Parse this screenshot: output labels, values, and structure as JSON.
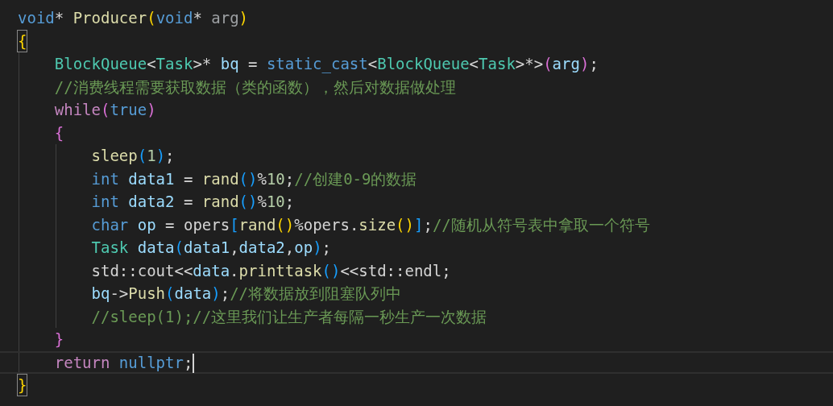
{
  "editor": {
    "lines": [
      {
        "current": false,
        "matched": false,
        "cursor": false,
        "tokens": [
          {
            "t": "void",
            "kind": "keyword"
          },
          {
            "t": "* ",
            "kind": "plain"
          },
          {
            "t": "Producer",
            "kind": "func"
          },
          {
            "t": "(",
            "kind": "b1"
          },
          {
            "t": "void",
            "kind": "keyword"
          },
          {
            "t": "* ",
            "kind": "plain"
          },
          {
            "t": "arg",
            "kind": "param"
          },
          {
            "t": ")",
            "kind": "b1"
          }
        ]
      },
      {
        "current": false,
        "matched": true,
        "cursor": false,
        "tokens": [
          {
            "t": "{",
            "kind": "b1"
          }
        ]
      },
      {
        "current": false,
        "matched": false,
        "cursor": false,
        "tokens": [
          {
            "t": "    BlockQueue",
            "kind": "type"
          },
          {
            "t": "<",
            "kind": "plain"
          },
          {
            "t": "Task",
            "kind": "type"
          },
          {
            "t": ">* ",
            "kind": "plain"
          },
          {
            "t": "bq",
            "kind": "var"
          },
          {
            "t": " = ",
            "kind": "plain"
          },
          {
            "t": "static_cast",
            "kind": "keyword"
          },
          {
            "t": "<",
            "kind": "plain"
          },
          {
            "t": "BlockQueue",
            "kind": "type"
          },
          {
            "t": "<",
            "kind": "plain"
          },
          {
            "t": "Task",
            "kind": "type"
          },
          {
            "t": ">*>",
            "kind": "plain"
          },
          {
            "t": "(",
            "kind": "b2"
          },
          {
            "t": "arg",
            "kind": "var"
          },
          {
            "t": ")",
            "kind": "b2"
          },
          {
            "t": ";",
            "kind": "plain"
          }
        ]
      },
      {
        "current": false,
        "matched": false,
        "cursor": false,
        "tokens": [
          {
            "t": "    //消费线程需要获取数据（类的函数），然后对数据做处理",
            "kind": "comment"
          }
        ]
      },
      {
        "current": false,
        "matched": false,
        "cursor": false,
        "tokens": [
          {
            "t": "    while",
            "kind": "control"
          },
          {
            "t": "(",
            "kind": "b2"
          },
          {
            "t": "true",
            "kind": "keyword"
          },
          {
            "t": ")",
            "kind": "b2"
          }
        ]
      },
      {
        "current": false,
        "matched": false,
        "cursor": false,
        "tokens": [
          {
            "t": "    {",
            "kind": "b2"
          }
        ]
      },
      {
        "current": false,
        "matched": false,
        "cursor": false,
        "tokens": [
          {
            "t": "        sleep",
            "kind": "func"
          },
          {
            "t": "(",
            "kind": "b3"
          },
          {
            "t": "1",
            "kind": "num"
          },
          {
            "t": ")",
            "kind": "b3"
          },
          {
            "t": ";",
            "kind": "plain"
          }
        ]
      },
      {
        "current": false,
        "matched": false,
        "cursor": false,
        "tokens": [
          {
            "t": "        int ",
            "kind": "keyword"
          },
          {
            "t": "data1",
            "kind": "var"
          },
          {
            "t": " = ",
            "kind": "plain"
          },
          {
            "t": "rand",
            "kind": "func"
          },
          {
            "t": "()",
            "kind": "b3"
          },
          {
            "t": "%",
            "kind": "plain"
          },
          {
            "t": "10",
            "kind": "num"
          },
          {
            "t": ";",
            "kind": "plain"
          },
          {
            "t": "//创建0-9的数据",
            "kind": "comment"
          }
        ]
      },
      {
        "current": false,
        "matched": false,
        "cursor": false,
        "tokens": [
          {
            "t": "        int ",
            "kind": "keyword"
          },
          {
            "t": "data2",
            "kind": "var"
          },
          {
            "t": " = ",
            "kind": "plain"
          },
          {
            "t": "rand",
            "kind": "func"
          },
          {
            "t": "()",
            "kind": "b3"
          },
          {
            "t": "%",
            "kind": "plain"
          },
          {
            "t": "10",
            "kind": "num"
          },
          {
            "t": ";",
            "kind": "plain"
          }
        ]
      },
      {
        "current": false,
        "matched": false,
        "cursor": false,
        "tokens": [
          {
            "t": "        char ",
            "kind": "keyword"
          },
          {
            "t": "op",
            "kind": "var"
          },
          {
            "t": " = ",
            "kind": "plain"
          },
          {
            "t": "opers",
            "kind": "plain"
          },
          {
            "t": "[",
            "kind": "b3"
          },
          {
            "t": "rand",
            "kind": "func"
          },
          {
            "t": "()",
            "kind": "b1"
          },
          {
            "t": "%opers.",
            "kind": "plain"
          },
          {
            "t": "size",
            "kind": "func"
          },
          {
            "t": "()",
            "kind": "b1"
          },
          {
            "t": "]",
            "kind": "b3"
          },
          {
            "t": ";",
            "kind": "plain"
          },
          {
            "t": "//随机从符号表中拿取一个符号",
            "kind": "comment"
          }
        ]
      },
      {
        "current": false,
        "matched": false,
        "cursor": false,
        "tokens": [
          {
            "t": "        Task ",
            "kind": "type"
          },
          {
            "t": "data",
            "kind": "var"
          },
          {
            "t": "(",
            "kind": "b3"
          },
          {
            "t": "data1",
            "kind": "var"
          },
          {
            "t": ",",
            "kind": "plain"
          },
          {
            "t": "data2",
            "kind": "var"
          },
          {
            "t": ",",
            "kind": "plain"
          },
          {
            "t": "op",
            "kind": "var"
          },
          {
            "t": ")",
            "kind": "b3"
          },
          {
            "t": ";",
            "kind": "plain"
          }
        ]
      },
      {
        "current": false,
        "matched": false,
        "cursor": false,
        "tokens": [
          {
            "t": "        std::cout<<",
            "kind": "plain"
          },
          {
            "t": "data",
            "kind": "var"
          },
          {
            "t": ".",
            "kind": "plain"
          },
          {
            "t": "printtask",
            "kind": "func"
          },
          {
            "t": "()",
            "kind": "b3"
          },
          {
            "t": "<<std::endl;",
            "kind": "plain"
          }
        ]
      },
      {
        "current": false,
        "matched": false,
        "cursor": false,
        "tokens": [
          {
            "t": "        bq",
            "kind": "var"
          },
          {
            "t": "->",
            "kind": "plain"
          },
          {
            "t": "Push",
            "kind": "func"
          },
          {
            "t": "(",
            "kind": "b3"
          },
          {
            "t": "data",
            "kind": "var"
          },
          {
            "t": ")",
            "kind": "b3"
          },
          {
            "t": ";",
            "kind": "plain"
          },
          {
            "t": "//将数据放到阻塞队列中",
            "kind": "comment"
          }
        ]
      },
      {
        "current": false,
        "matched": false,
        "cursor": false,
        "tokens": [
          {
            "t": "        //sleep(1);//这里我们让生产者每隔一秒生产一次数据",
            "kind": "comment"
          }
        ]
      },
      {
        "current": false,
        "matched": false,
        "cursor": false,
        "tokens": [
          {
            "t": "    }",
            "kind": "b2"
          }
        ]
      },
      {
        "current": true,
        "matched": false,
        "cursor": true,
        "tokens": [
          {
            "t": "    return ",
            "kind": "control"
          },
          {
            "t": "nullptr",
            "kind": "keyword"
          },
          {
            "t": ";",
            "kind": "plain"
          }
        ]
      },
      {
        "current": false,
        "matched": true,
        "cursor": false,
        "tokens": [
          {
            "t": "}",
            "kind": "b1"
          }
        ]
      }
    ]
  }
}
